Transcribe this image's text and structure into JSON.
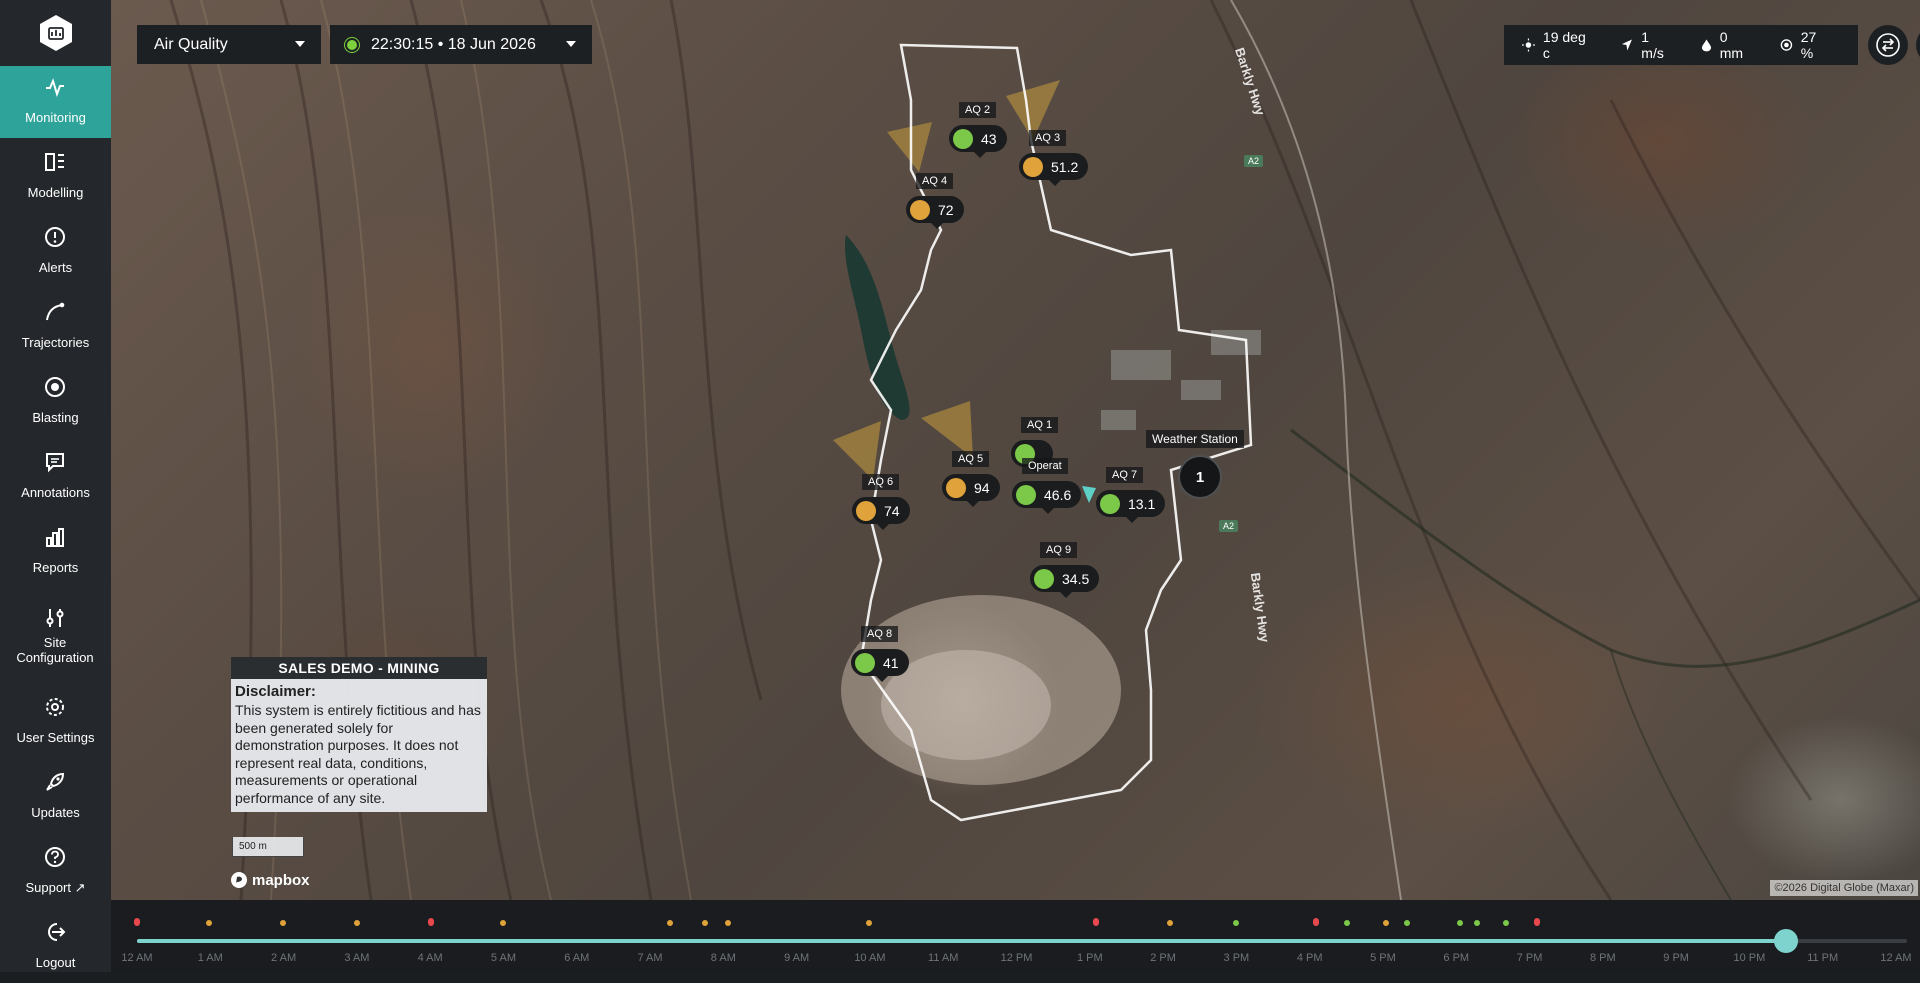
{
  "sidebar": {
    "logo": "app-logo",
    "items": [
      {
        "label": "Monitoring",
        "icon": "pulse-icon",
        "active": true
      },
      {
        "label": "Modelling",
        "icon": "modelling-icon"
      },
      {
        "label": "Alerts",
        "icon": "alert-circle-icon"
      },
      {
        "label": "Trajectories",
        "icon": "trajectory-icon"
      },
      {
        "label": "Blasting",
        "icon": "target-icon"
      },
      {
        "label": "Annotations",
        "icon": "comment-icon"
      },
      {
        "label": "Reports",
        "icon": "bar-chart-icon"
      },
      {
        "label": "Site Configuration",
        "icon": "sliders-icon"
      },
      {
        "label": "User Settings",
        "icon": "gear-icon"
      },
      {
        "label": "Updates",
        "icon": "rocket-icon"
      },
      {
        "label": "Support",
        "icon": "help-icon"
      },
      {
        "label": "Logout",
        "icon": "logout-icon"
      }
    ]
  },
  "toolbar": {
    "layer_select": "Air Quality",
    "time_display": "22:30:15 • 18 Jun 2026"
  },
  "weather": {
    "temperature": "19 deg c",
    "wind": "1 m/s",
    "rain": "0 mm",
    "humidity": "27 %"
  },
  "map": {
    "road_name": "Barkly Hwy",
    "road_badge": "A2",
    "weather_station_label": "Weather Station",
    "cluster_count": "1",
    "sensors": [
      {
        "name": "AQ 2",
        "value": "43",
        "status": "green"
      },
      {
        "name": "AQ 3",
        "value": "51.2",
        "status": "amber"
      },
      {
        "name": "AQ 4",
        "value": "72",
        "status": "amber"
      },
      {
        "name": "AQ 5",
        "value": "94",
        "status": "amber"
      },
      {
        "name": "AQ 6",
        "value": "74",
        "status": "amber"
      },
      {
        "name": "AQ 1",
        "value": "",
        "status": "green"
      },
      {
        "name": "Operat",
        "value": "46.6",
        "status": "green"
      },
      {
        "name": "AQ 7",
        "value": "13.1",
        "status": "green"
      },
      {
        "name": "AQ 9",
        "value": "34.5",
        "status": "green"
      },
      {
        "name": "AQ 8",
        "value": "41",
        "status": "green"
      }
    ],
    "disclaimer_title": "SALES DEMO - MINING",
    "disclaimer_heading": "Disclaimer:",
    "disclaimer_text": "This system is entirely fictitious and has been generated solely for demonstration purposes. It does not represent real data, conditions, measurements or operational performance of any site.",
    "scale_label": "500 m",
    "mapbox_label": "mapbox",
    "attribution": "©2026 Digital Globe (Maxar)"
  },
  "timeline": {
    "labels": [
      "12 AM",
      "1 AM",
      "2 AM",
      "3 AM",
      "4 AM",
      "5 AM",
      "6 AM",
      "7 AM",
      "8 AM",
      "9 AM",
      "10 AM",
      "11 AM",
      "12 PM",
      "1 PM",
      "2 PM",
      "3 PM",
      "4 PM",
      "5 PM",
      "6 PM",
      "7 PM",
      "8 PM",
      "9 PM",
      "10 PM",
      "11 PM",
      "12 AM"
    ],
    "progress": 0.9375,
    "event_colors": {
      "red": "#e5484d",
      "amber": "#e0a23b",
      "green": "#7cc94a"
    }
  },
  "colors": {
    "accent": "#2ea39a",
    "sidebar_bg": "#24272b",
    "panel_bg": "#1d2023"
  }
}
